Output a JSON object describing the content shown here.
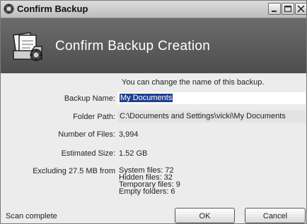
{
  "window": {
    "title": "Confirm Backup",
    "icon": "backup-gear-icon",
    "controls": [
      "minimize-icon",
      "maximize-icon",
      "close-icon"
    ]
  },
  "header": {
    "title": "Confirm Backup Creation",
    "icon": "documents-backup-icon"
  },
  "form": {
    "hint": "You can change the name of this backup.",
    "backup_name_label": "Backup Name:",
    "backup_name_value": "My Documents",
    "folder_path_label": "Folder Path:",
    "folder_path_value": "C:\\Documents and Settings\\vicki\\My Documents",
    "num_files_label": "Number of Files:",
    "num_files_value": "3,994",
    "est_size_label": "Estimated Size:",
    "est_size_value": "1.52 GB",
    "excluding_label": "Excluding 27.5 MB from",
    "excluded": [
      "System files: 72",
      "Hidden files: 32",
      "Temporary files: 9",
      "Empty folders: 6"
    ]
  },
  "footer": {
    "status": "Scan complete",
    "ok_label": "OK",
    "cancel_label": "Cancel"
  }
}
